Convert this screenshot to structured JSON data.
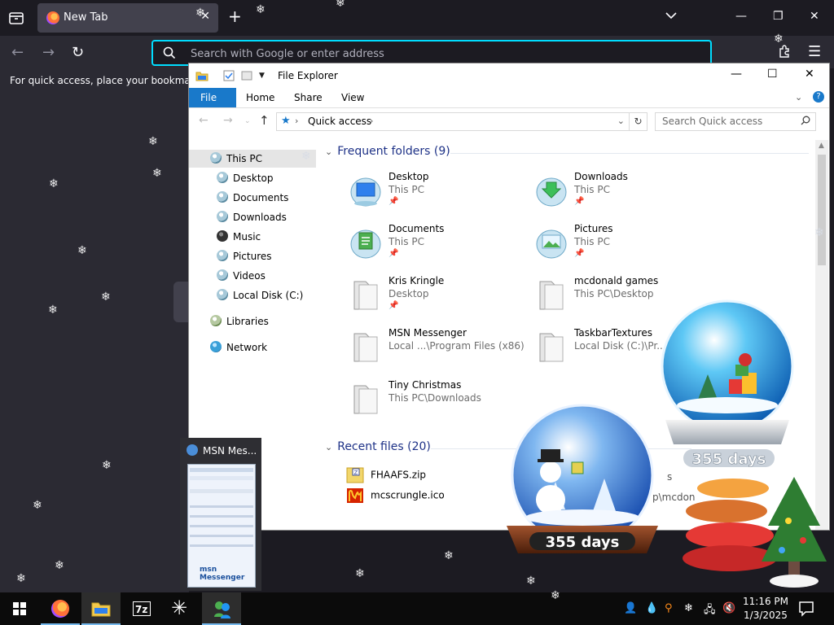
{
  "browser": {
    "tab_title": "New Tab",
    "new_tab_symbol": "+",
    "url_placeholder": "Search with Google or enter address",
    "bookmarks_hint": "For quick access, place your bookmarks h"
  },
  "explorer": {
    "title": "File Explorer",
    "ribbon_tabs": [
      "File",
      "Home",
      "Share",
      "View"
    ],
    "address": {
      "location": "Quick access"
    },
    "search_placeholder": "Search Quick access",
    "nav_items": [
      {
        "label": "This PC",
        "icon": "this-pc-icon"
      },
      {
        "label": "Desktop",
        "icon": "desktop-icon"
      },
      {
        "label": "Documents",
        "icon": "documents-icon"
      },
      {
        "label": "Downloads",
        "icon": "downloads-icon"
      },
      {
        "label": "Music",
        "icon": "music-icon"
      },
      {
        "label": "Pictures",
        "icon": "pictures-icon"
      },
      {
        "label": "Videos",
        "icon": "videos-icon"
      },
      {
        "label": "Local Disk (C:)",
        "icon": "local-disk-icon"
      },
      {
        "label": "Libraries",
        "icon": "libraries-icon"
      },
      {
        "label": "Network",
        "icon": "network-icon"
      }
    ],
    "frequent_header": "Frequent folders (9)",
    "folders": [
      {
        "name": "Desktop",
        "path": "This PC",
        "pinned": true
      },
      {
        "name": "Downloads",
        "path": "This PC",
        "pinned": true
      },
      {
        "name": "Documents",
        "path": "This PC",
        "pinned": true
      },
      {
        "name": "Pictures",
        "path": "This PC",
        "pinned": true
      },
      {
        "name": "Kris Kringle",
        "path": "Desktop",
        "pinned": true
      },
      {
        "name": "mcdonald games",
        "path": "This PC\\Desktop",
        "pinned": false
      },
      {
        "name": "MSN Messenger",
        "path": "Local ...\\Program Files (x86)",
        "pinned": false
      },
      {
        "name": "TaskbarTextures",
        "path": "Local Disk (C:)\\Pr...",
        "pinned": false
      },
      {
        "name": "Tiny Christmas",
        "path": "This PC\\Downloads",
        "pinned": false
      }
    ],
    "recent_header": "Recent files (20)",
    "recent_files": [
      {
        "name": "FHAAFS.zip",
        "location": "s"
      },
      {
        "name": "mcscrungle.ico",
        "location": "p\\mcdon"
      }
    ]
  },
  "msn_preview": {
    "title": "MSN Mes...",
    "logo": "msn Messenger"
  },
  "globes": {
    "days_label": "355 days"
  },
  "taskbar": {
    "time": "11:16 PM",
    "date": "1/3/2025"
  },
  "colors": {
    "accent": "#00ddff",
    "explorer_blue": "#1979ca",
    "header_blue": "#1e3287",
    "browser_bg": "#1c1b22"
  }
}
